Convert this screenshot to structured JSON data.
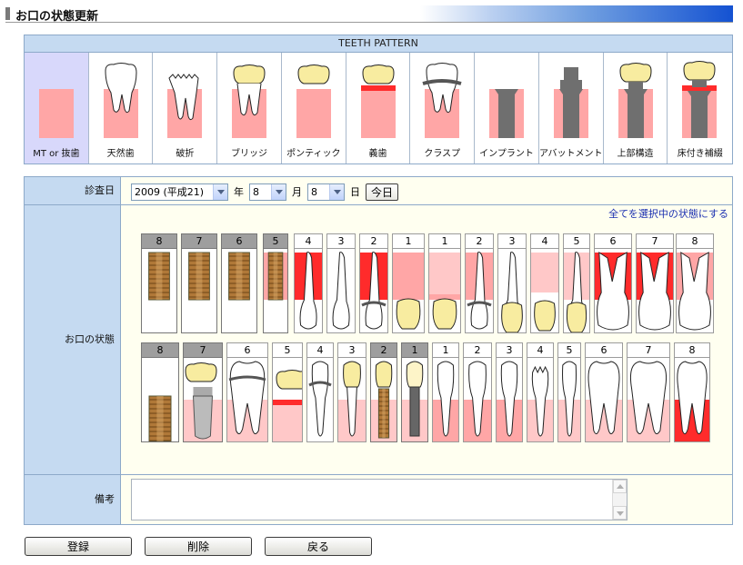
{
  "page": {
    "title": "お口の状態更新"
  },
  "pattern": {
    "header": "TEETH PATTERN",
    "items": [
      {
        "id": "mt",
        "label": "MT or 抜歯",
        "icon": "missing-tooth-icon"
      },
      {
        "id": "natural",
        "label": "天然歯",
        "icon": "natural-tooth-icon"
      },
      {
        "id": "fracture",
        "label": "破折",
        "icon": "fractured-tooth-icon"
      },
      {
        "id": "bridge",
        "label": "ブリッジ",
        "icon": "bridge-tooth-icon"
      },
      {
        "id": "pontic",
        "label": "ポンティック",
        "icon": "pontic-tooth-icon"
      },
      {
        "id": "denture",
        "label": "義歯",
        "icon": "denture-tooth-icon"
      },
      {
        "id": "clasp",
        "label": "クラスプ",
        "icon": "clasp-tooth-icon"
      },
      {
        "id": "implant",
        "label": "インプラント",
        "icon": "implant-icon"
      },
      {
        "id": "abutment",
        "label": "アバットメント",
        "icon": "abutment-icon"
      },
      {
        "id": "superstructure",
        "label": "上部構造",
        "icon": "superstructure-icon"
      },
      {
        "id": "floor_restoration",
        "label": "床付き補綴",
        "icon": "floor-restoration-icon"
      }
    ]
  },
  "form": {
    "date_label": "診査日",
    "year_value": "2009 (平成21)",
    "year_unit": "年",
    "month_value": "8",
    "month_unit": "月",
    "day_value": "8",
    "day_unit": "日",
    "today_button": "今日",
    "select_all_link": "全てを選択中の状態にする",
    "mouth_label": "お口の状態",
    "remarks_label": "備考",
    "remarks_value": ""
  },
  "teeth": {
    "upper": [
      {
        "num": "8",
        "state": "implant",
        "grey": true
      },
      {
        "num": "7",
        "state": "implant",
        "grey": true
      },
      {
        "num": "6",
        "state": "implant",
        "grey": true
      },
      {
        "num": "5",
        "state": "implant-pink",
        "grey": true
      },
      {
        "num": "4",
        "state": "canine-red"
      },
      {
        "num": "3",
        "state": "canine-white"
      },
      {
        "num": "2",
        "state": "clasp-red"
      },
      {
        "num": "1",
        "state": "crown-pink"
      },
      {
        "num": "1",
        "state": "crown-lightpink"
      },
      {
        "num": "2",
        "state": "clasp-pink"
      },
      {
        "num": "3",
        "state": "canine-yellowcrown"
      },
      {
        "num": "4",
        "state": "crown-lightpink-small"
      },
      {
        "num": "5",
        "state": "premolar-yellow"
      },
      {
        "num": "6",
        "state": "molar-red"
      },
      {
        "num": "7",
        "state": "molar-red"
      },
      {
        "num": "8",
        "state": "molar-pink"
      }
    ],
    "lower": [
      {
        "num": "8",
        "state": "implant-lower",
        "grey": true
      },
      {
        "num": "7",
        "state": "superstructure-lower",
        "grey": true
      },
      {
        "num": "6",
        "state": "molar-clasp"
      },
      {
        "num": "5",
        "state": "pontic-lower"
      },
      {
        "num": "4",
        "state": "clasp-lower"
      },
      {
        "num": "3",
        "state": "bridge-lower"
      },
      {
        "num": "2",
        "state": "abutment-lower",
        "grey": true
      },
      {
        "num": "1",
        "state": "implant-post-lower",
        "grey": true
      },
      {
        "num": "1",
        "state": "incisor-pink"
      },
      {
        "num": "2",
        "state": "incisor-pink"
      },
      {
        "num": "3",
        "state": "incisor-pink"
      },
      {
        "num": "4",
        "state": "fracture-lower"
      },
      {
        "num": "5",
        "state": "premolar-pink"
      },
      {
        "num": "6",
        "state": "molar-lower-pink"
      },
      {
        "num": "7",
        "state": "molar-lower-pink"
      },
      {
        "num": "8",
        "state": "molar-lower-red"
      }
    ]
  },
  "buttons": {
    "register": "登録",
    "delete": "削除",
    "back": "戻る"
  },
  "colors": {
    "header_blue": "#c5daf1",
    "pink": "#ffa6a6",
    "light_pink": "#ffc8c8",
    "red": "#ff2b2b",
    "gold": "#f8eca0",
    "implant_bronze": "#b07838"
  }
}
